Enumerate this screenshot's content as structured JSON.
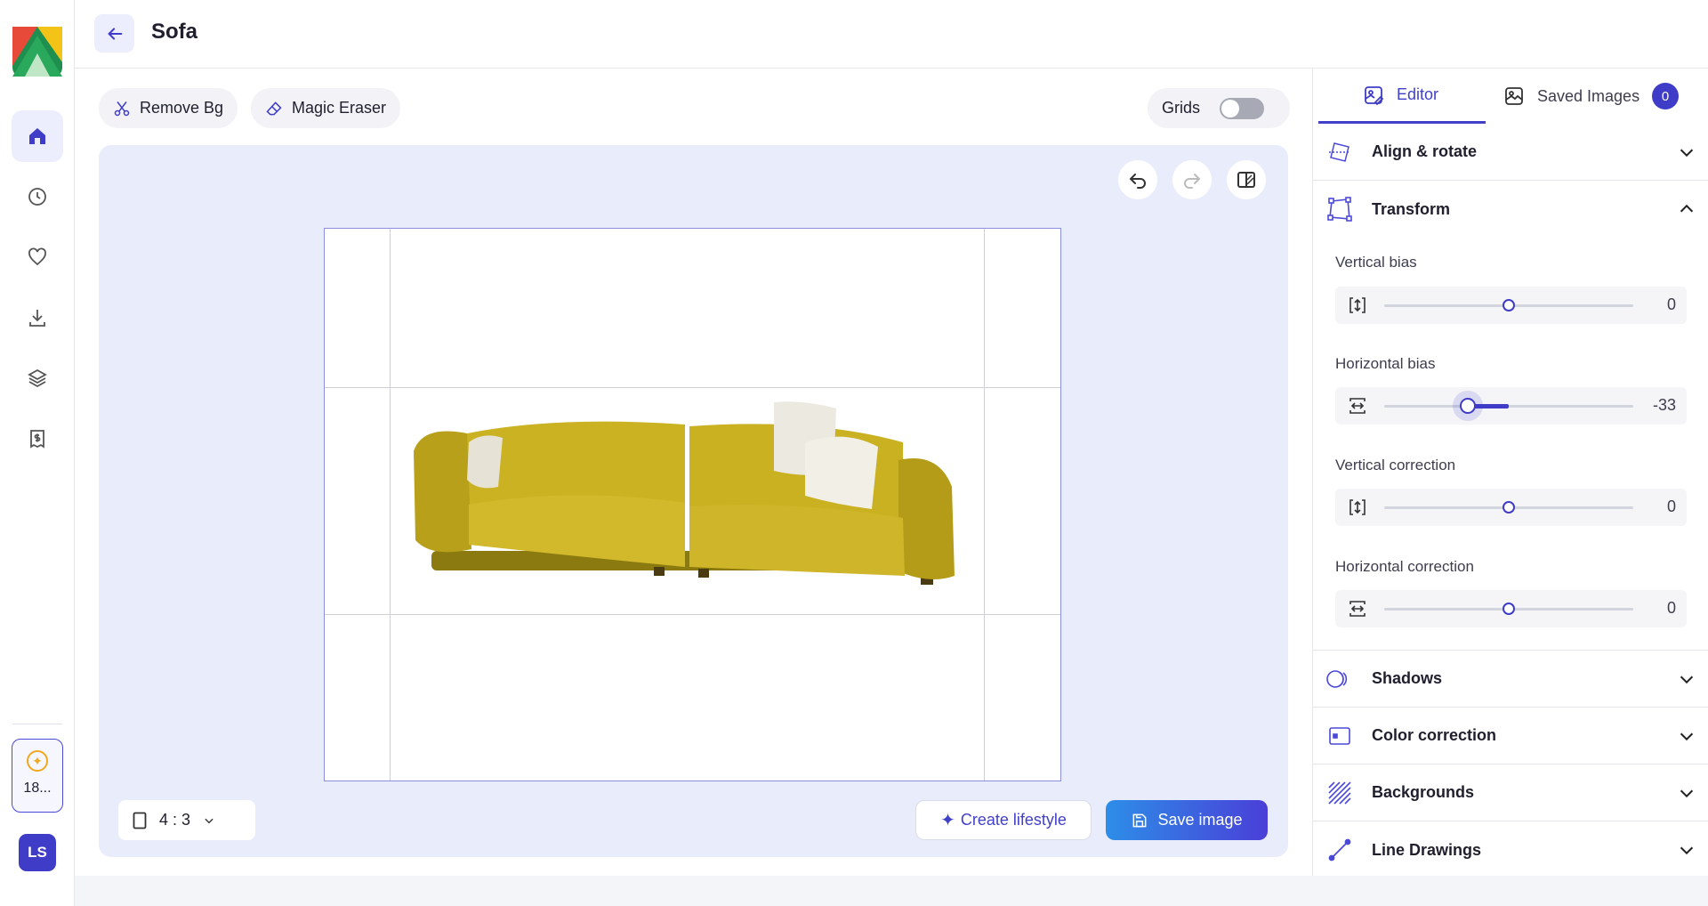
{
  "nav": {
    "items": [
      "home-icon",
      "history-icon",
      "favorites-icon",
      "downloads-icon",
      "layers-icon",
      "receipt-icon"
    ],
    "credits": "18...",
    "avatar": "LS"
  },
  "header": {
    "title": "Sofa"
  },
  "toolbar": {
    "remove_bg": "Remove Bg",
    "magic_eraser": "Magic Eraser",
    "grids": "Grids",
    "grids_on": false
  },
  "canvas": {
    "ratio": "4 : 3",
    "create_lifestyle": "Create lifestyle",
    "save_image": "Save image"
  },
  "panel": {
    "tabs": [
      {
        "label": "Editor",
        "active": true
      },
      {
        "label": "Saved Images",
        "badge": "0"
      }
    ],
    "sections": {
      "align": "Align & rotate",
      "transform": "Transform",
      "shadows": "Shadows",
      "color": "Color correction",
      "backgrounds": "Backgrounds",
      "line": "Line Drawings"
    },
    "controls": [
      {
        "label": "Vertical bias",
        "value": "0",
        "fraction": 0.5
      },
      {
        "label": "Horizontal bias",
        "value": "-33",
        "fraction": 0.335
      },
      {
        "label": "Vertical correction",
        "value": "0",
        "fraction": 0.5
      },
      {
        "label": "Horizontal correction",
        "value": "0",
        "fraction": 0.5
      }
    ]
  },
  "colors": {
    "accent": "#3f3cc7",
    "canvas_bg": "#e9ecfa"
  }
}
